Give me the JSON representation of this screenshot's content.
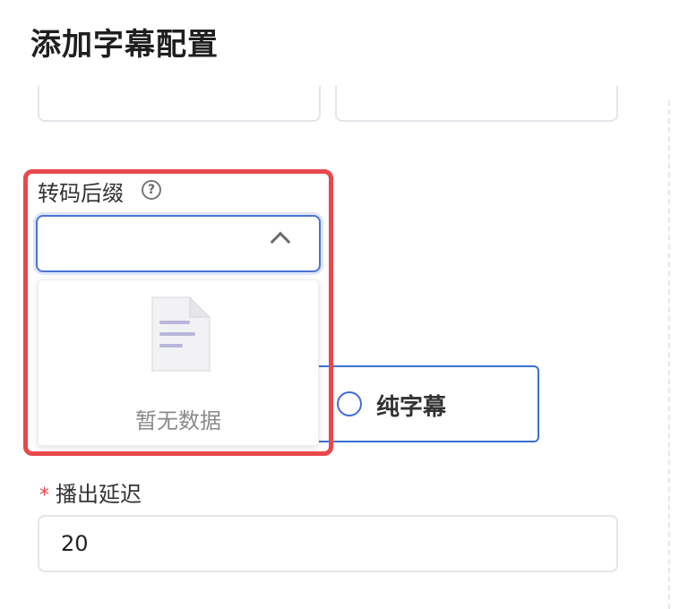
{
  "header": {
    "title": "添加字幕配置"
  },
  "transcode_suffix": {
    "label": "转码后缀",
    "help_glyph": "?",
    "value": "",
    "empty_text": "暂无数据"
  },
  "subtitle_mode": {
    "option_label": "纯字幕"
  },
  "playout_delay": {
    "required_mark": "*",
    "label": "播出延迟",
    "value": "20"
  },
  "colors": {
    "highlight": "#e8484b",
    "accent": "#4a74d6"
  }
}
